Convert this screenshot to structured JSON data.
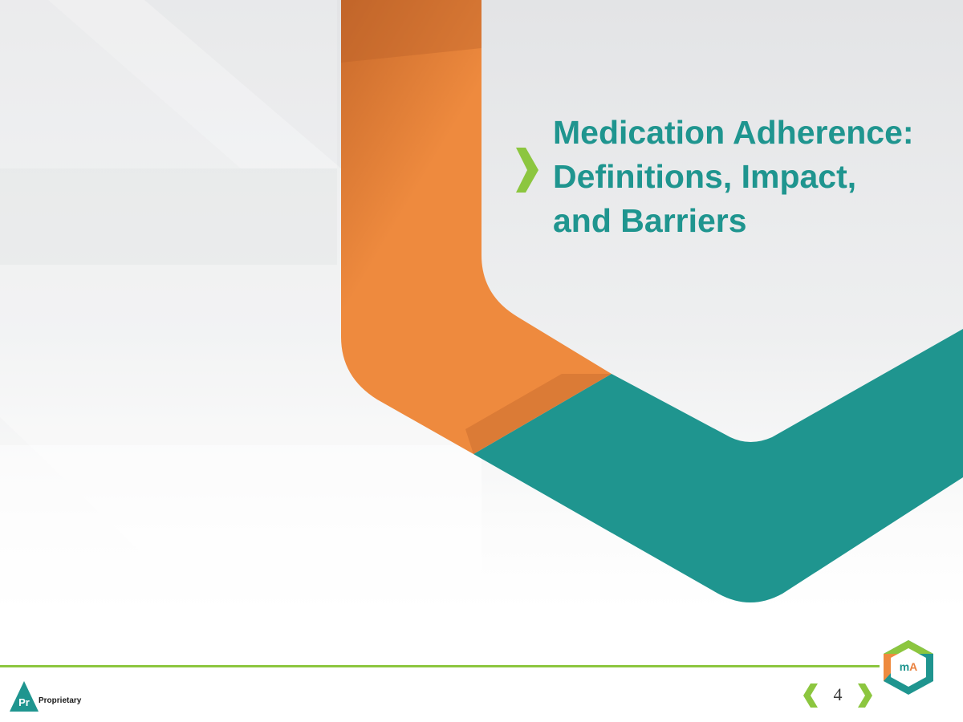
{
  "slide": {
    "title_lines": [
      "Medication Adherence:",
      "Definitions, Impact,",
      "and Barriers"
    ],
    "page_number": "4"
  },
  "footer": {
    "badge_abbr": "Pr",
    "badge_label": "Proprietary",
    "logo_letter_m": "m",
    "logo_letter_a": "A"
  },
  "icons": {
    "title_marker": "chevron-right-icon",
    "prev": "chevron-left-icon",
    "next": "chevron-right-icon",
    "logo": "hexagon-logo-icon"
  },
  "colors": {
    "teal": "#1f958f",
    "orange": "#ee8a3e",
    "green": "#8cc63f",
    "background_gray": "#e6e7e9"
  }
}
